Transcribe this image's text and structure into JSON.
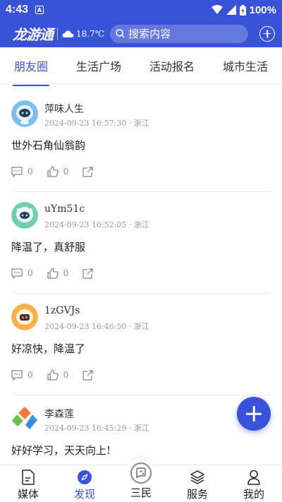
{
  "status_bar": {
    "time": "4:43",
    "notification_letter": "A",
    "battery": "100%"
  },
  "header": {
    "logo": "龙游通",
    "weather": "18.7℃",
    "search_placeholder": "搜索内容"
  },
  "tabs": [
    {
      "label": "朋友圈",
      "active": true
    },
    {
      "label": "生活广场",
      "active": false
    },
    {
      "label": "活动报名",
      "active": false
    },
    {
      "label": "城市生活",
      "active": false
    }
  ],
  "posts": [
    {
      "author": "萍味人生",
      "meta": "2024-09-23 16:57:30 · 浙江",
      "content": "世外石角仙翁韵",
      "comments": "0",
      "likes": "0"
    },
    {
      "author": "uYm51c",
      "meta": "2024-09-23 16:52:05 · 浙江",
      "content": "降温了，真舒服",
      "comments": "0",
      "likes": "0"
    },
    {
      "author": "1zGVJs",
      "meta": "2024-09-23 16:46:50 · 浙江",
      "content": "好凉快，降温了",
      "comments": "0",
      "likes": "0"
    },
    {
      "author": "李森莲",
      "meta": "2024-09-23 16:45:29 · 浙江",
      "content": "好好学习，天天向上!",
      "comments": "",
      "likes": ""
    }
  ],
  "bottom_nav": [
    {
      "label": "媒体",
      "icon": "document-icon",
      "active": false
    },
    {
      "label": "发现",
      "icon": "compass-icon",
      "active": true
    },
    {
      "label": "三民",
      "icon": "sanmin-icon",
      "active": false
    },
    {
      "label": "服务",
      "icon": "layers-icon",
      "active": false
    },
    {
      "label": "我的",
      "icon": "person-icon",
      "active": false
    }
  ],
  "colors": {
    "primary": "#3a52d8",
    "text": "#222222",
    "muted": "#999999"
  }
}
